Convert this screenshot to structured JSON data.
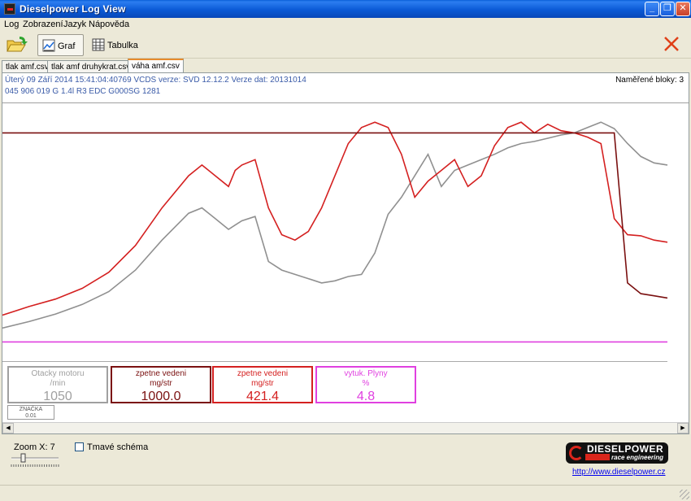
{
  "window": {
    "title": "Dieselpower Log View"
  },
  "menu": [
    "Log",
    "Zobrazení",
    "Jazyk",
    "Nápověda"
  ],
  "toolbar": {
    "graf_label": "Graf",
    "tabulka_label": "Tabulka"
  },
  "file_tabs": [
    "tlak amf.csv",
    "tlak amf druhykrat.csv",
    "váha amf.csv"
  ],
  "info": {
    "line1": "Úterý 09 Září 2014 15:41:04:40769 VCDS verze: SVD 12.12.2 Verze dat: 20131014",
    "line2": "045 906 019 G  1.4l R3 EDC G000SG  1281",
    "blocks_label": "Naměřené bloky:",
    "blocks_value": "3"
  },
  "value_boxes": [
    {
      "name": "Otacky motoru",
      "unit": "/min",
      "value": "1050",
      "color": "#a0a0a0"
    },
    {
      "name": "zpetne vedeni",
      "unit": "mg/str",
      "value": "1000.0",
      "color": "#7a1010"
    },
    {
      "name": "zpetne vedeni",
      "unit": "mg/str",
      "value": "421.4",
      "color": "#d42020"
    },
    {
      "name": "vytuk. Plyny",
      "unit": "%",
      "value": "4.8",
      "color": "#e040e0"
    }
  ],
  "marker": {
    "label": "ZNAČKA",
    "value": "0.01"
  },
  "bottom": {
    "zoom_label": "Zoom X:",
    "zoom_value": "7",
    "dark_scheme_label": "Tmavé schéma",
    "dark_scheme_checked": false,
    "logo_brand": "DIESELPOWER",
    "logo_sub": "race engineering",
    "link": "http://www.dieselpower.cz"
  },
  "chart_data": {
    "type": "line",
    "x": [
      0,
      4,
      8,
      12,
      16,
      20,
      24,
      28,
      30,
      32,
      34,
      35,
      36,
      38,
      40,
      42,
      44,
      46,
      48,
      50,
      52,
      54,
      56,
      58,
      60,
      62,
      64,
      66,
      68,
      70,
      72,
      74,
      76,
      78,
      80,
      82,
      84,
      86,
      88,
      90,
      92,
      94,
      96,
      98,
      100
    ],
    "ylim": [
      0,
      100
    ],
    "grid": false,
    "series": [
      {
        "color": "#909090",
        "values": [
          18,
          24,
          31,
          40,
          52,
          72,
          100,
          125,
          130,
          120,
          110,
          114,
          118,
          122,
          80,
          72,
          68,
          64,
          60,
          62,
          66,
          68,
          88,
          124,
          140,
          160,
          180,
          150,
          165,
          170,
          175,
          180,
          186,
          190,
          192,
          195,
          198,
          200,
          205,
          210,
          204,
          190,
          178,
          172,
          170
        ]
      },
      {
        "color": "#d42020",
        "values": [
          30,
          38,
          45,
          55,
          70,
          95,
          130,
          160,
          170,
          160,
          150,
          165,
          170,
          175,
          130,
          105,
          100,
          108,
          130,
          160,
          190,
          205,
          210,
          205,
          180,
          140,
          155,
          165,
          175,
          150,
          160,
          188,
          205,
          210,
          200,
          208,
          202,
          200,
          196,
          190,
          120,
          105,
          104,
          100,
          98
        ]
      },
      {
        "color": "#7a1010",
        "values": [
          200,
          200,
          200,
          200,
          200,
          200,
          200,
          200,
          200,
          200,
          200,
          200,
          200,
          200,
          200,
          200,
          200,
          200,
          200,
          200,
          200,
          200,
          200,
          200,
          200,
          200,
          200,
          200,
          200,
          200,
          200,
          200,
          200,
          200,
          200,
          200,
          200,
          200,
          200,
          200,
          200,
          60,
          50,
          48,
          46
        ]
      },
      {
        "color": "#e040e0",
        "values": [
          5,
          5,
          5,
          5,
          5,
          5,
          5,
          5,
          5,
          5,
          5,
          5,
          5,
          5,
          5,
          5,
          5,
          5,
          5,
          5,
          5,
          5,
          5,
          5,
          5,
          5,
          5,
          5,
          5,
          5,
          5,
          5,
          5,
          5,
          5,
          5,
          5,
          5,
          5,
          5,
          5,
          5,
          5,
          5,
          5
        ]
      }
    ]
  }
}
